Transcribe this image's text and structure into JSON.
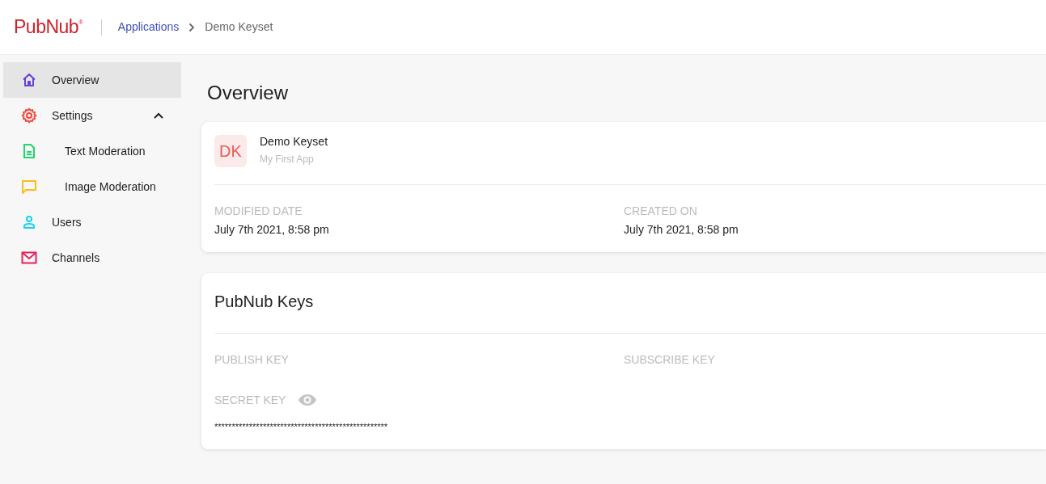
{
  "header": {
    "logo": "PubNub",
    "logo_mark": "®",
    "breadcrumb": [
      {
        "label": "Applications",
        "link": true
      },
      {
        "label": "Demo Keyset",
        "link": false
      }
    ]
  },
  "sidebar": {
    "items": [
      {
        "label": "Overview",
        "kind": "home",
        "color": "#6b3fd1",
        "selected": true
      },
      {
        "label": "Settings",
        "kind": "gear",
        "color": "#f0453a",
        "selected": false,
        "expanded": true,
        "children": [
          {
            "label": "Text Moderation",
            "kind": "document",
            "color": "#1ed66e",
            "selected": false
          },
          {
            "label": "Image Moderation",
            "kind": "chat",
            "color": "#fdbd12",
            "selected": false
          }
        ]
      },
      {
        "label": "Users",
        "kind": "person",
        "color": "#19d1f0",
        "selected": false
      },
      {
        "label": "Channels",
        "kind": "mail",
        "color": "#e8205a",
        "selected": false
      }
    ]
  },
  "page_title": "Overview",
  "keyset_card": {
    "avatar": "DK",
    "name": "Demo Keyset",
    "app": "My First App",
    "fields": [
      {
        "label": "MODIFIED DATE",
        "value": "July 7th 2021, 8:58 pm"
      },
      {
        "label": "CREATED ON",
        "value": "July 7th 2021, 8:58 pm"
      }
    ]
  },
  "keys_card": {
    "title": "PubNub Keys",
    "fields": [
      {
        "label": "PUBLISH KEY"
      },
      {
        "label": "SUBSCRIBE KEY"
      }
    ],
    "secret": {
      "label": "SECRET KEY",
      "value": "**************************************************"
    }
  }
}
